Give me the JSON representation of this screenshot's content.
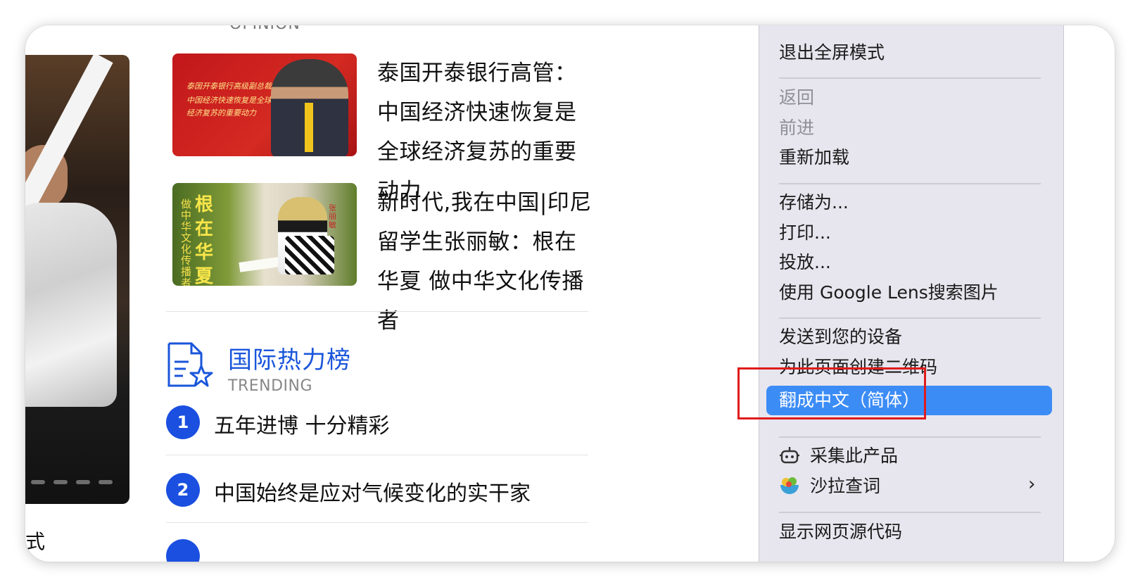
{
  "top_cutoff_label": "OPINION",
  "news": [
    {
      "title": "泰国开泰银行高管：中国经济快速恢复是全球经济复苏的重要动力",
      "thumb_text": [
        "泰国开泰银行高级副总裁：",
        "中国经济快速恢复是全球",
        "经济复苏的重要动力"
      ]
    },
    {
      "title": "新时代,我在中国|印尼留学生张丽敏：根在华夏 做中华文化传播者",
      "thumb_text_small": "做中华文化传播者",
      "thumb_text_big": "根在华夏",
      "thumb_name": "张丽敏"
    }
  ],
  "trending": {
    "title": "国际热力榜",
    "subtitle": "TRENDING",
    "items": [
      {
        "rank": "1",
        "text": "五年进博 十分精彩"
      },
      {
        "rank": "2",
        "text": "中国始终是应对气候变化的实干家"
      }
    ]
  },
  "bottom_cutoff_text": "式",
  "context_menu": {
    "exit_fullscreen": "退出全屏模式",
    "back": "返回",
    "forward": "前进",
    "reload": "重新加载",
    "save_as": "存储为...",
    "print": "打印...",
    "cast": "投放...",
    "google_lens": "使用 Google Lens搜索图片",
    "send_to_devices": "发送到您的设备",
    "create_qr": "为此页面创建二维码",
    "translate": "翻成中文（简体）",
    "collect_product": "采集此产品",
    "salad_dict": "沙拉查词",
    "view_source": "显示网页源代码"
  },
  "colors": {
    "accent_blue": "#1a56db",
    "menu_highlight": "#3c8cf6",
    "annotation_red": "#e01b1b"
  }
}
